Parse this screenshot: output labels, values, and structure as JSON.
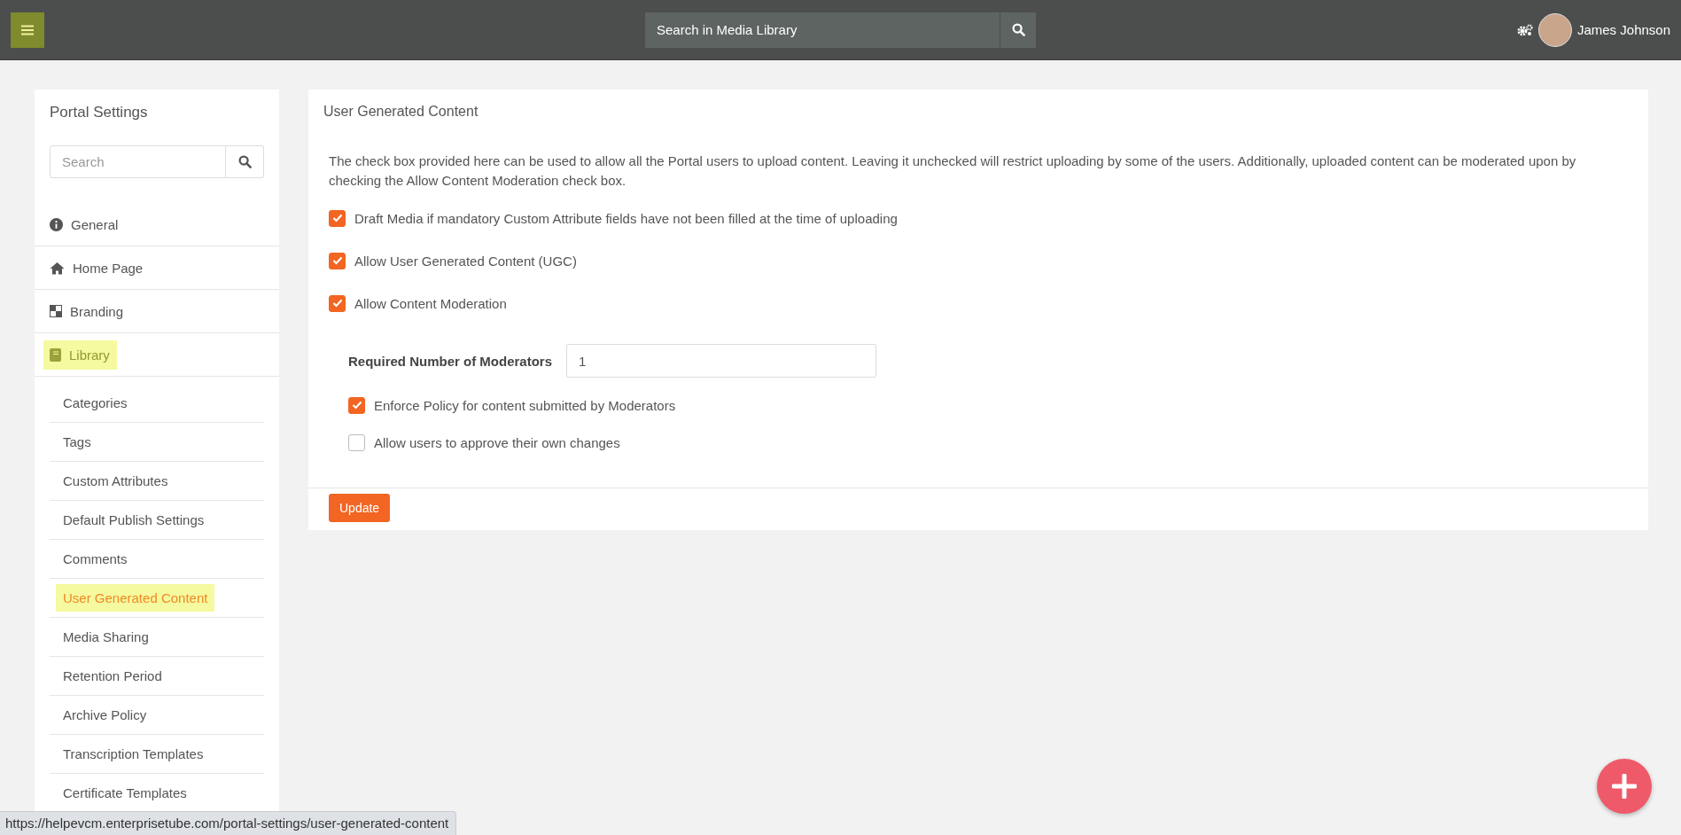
{
  "topbar": {
    "search": {
      "placeholder": "Search in Media Library"
    },
    "user": {
      "name": "James Johnson"
    }
  },
  "sidebar": {
    "title": "Portal Settings",
    "search": {
      "placeholder": "Search"
    },
    "items": [
      {
        "label": "General",
        "selected": false
      },
      {
        "label": "Home Page",
        "selected": false
      },
      {
        "label": "Branding",
        "selected": false
      },
      {
        "label": "Library",
        "selected": true,
        "children": [
          {
            "label": "Categories",
            "selected": false
          },
          {
            "label": "Tags",
            "selected": false
          },
          {
            "label": "Custom Attributes",
            "selected": false
          },
          {
            "label": "Default Publish Settings",
            "selected": false
          },
          {
            "label": "Comments",
            "selected": false
          },
          {
            "label": "User Generated Content",
            "selected": true
          },
          {
            "label": "Media Sharing",
            "selected": false
          },
          {
            "label": "Retention Period",
            "selected": false
          },
          {
            "label": "Archive Policy",
            "selected": false
          },
          {
            "label": "Transcription Templates",
            "selected": false
          },
          {
            "label": "Certificate Templates",
            "selected": false
          }
        ]
      }
    ]
  },
  "content": {
    "title": "User Generated Content",
    "description": "The check box provided here can be used to allow all the Portal users to upload content. Leaving it unchecked will restrict uploading by some of the users. Additionally, uploaded content can be moderated upon by checking the Allow Content Moderation check box.",
    "options": [
      {
        "label": "Draft Media if mandatory Custom Attribute fields have not been filled at the time of uploading",
        "checked": true
      },
      {
        "label": "Allow User Generated Content (UGC)",
        "checked": true
      },
      {
        "label": "Allow Content Moderation",
        "checked": true
      }
    ],
    "moderators": {
      "label": "Required Number of Moderators",
      "value": "1"
    },
    "sub_options": [
      {
        "label": "Enforce Policy for content submitted by Moderators",
        "checked": true
      },
      {
        "label": "Allow users to approve their own changes",
        "checked": false
      }
    ],
    "button": "Update"
  },
  "status_bar": {
    "url": "https://helpevcm.enterprisetube.com/portal-settings/user-generated-content"
  }
}
